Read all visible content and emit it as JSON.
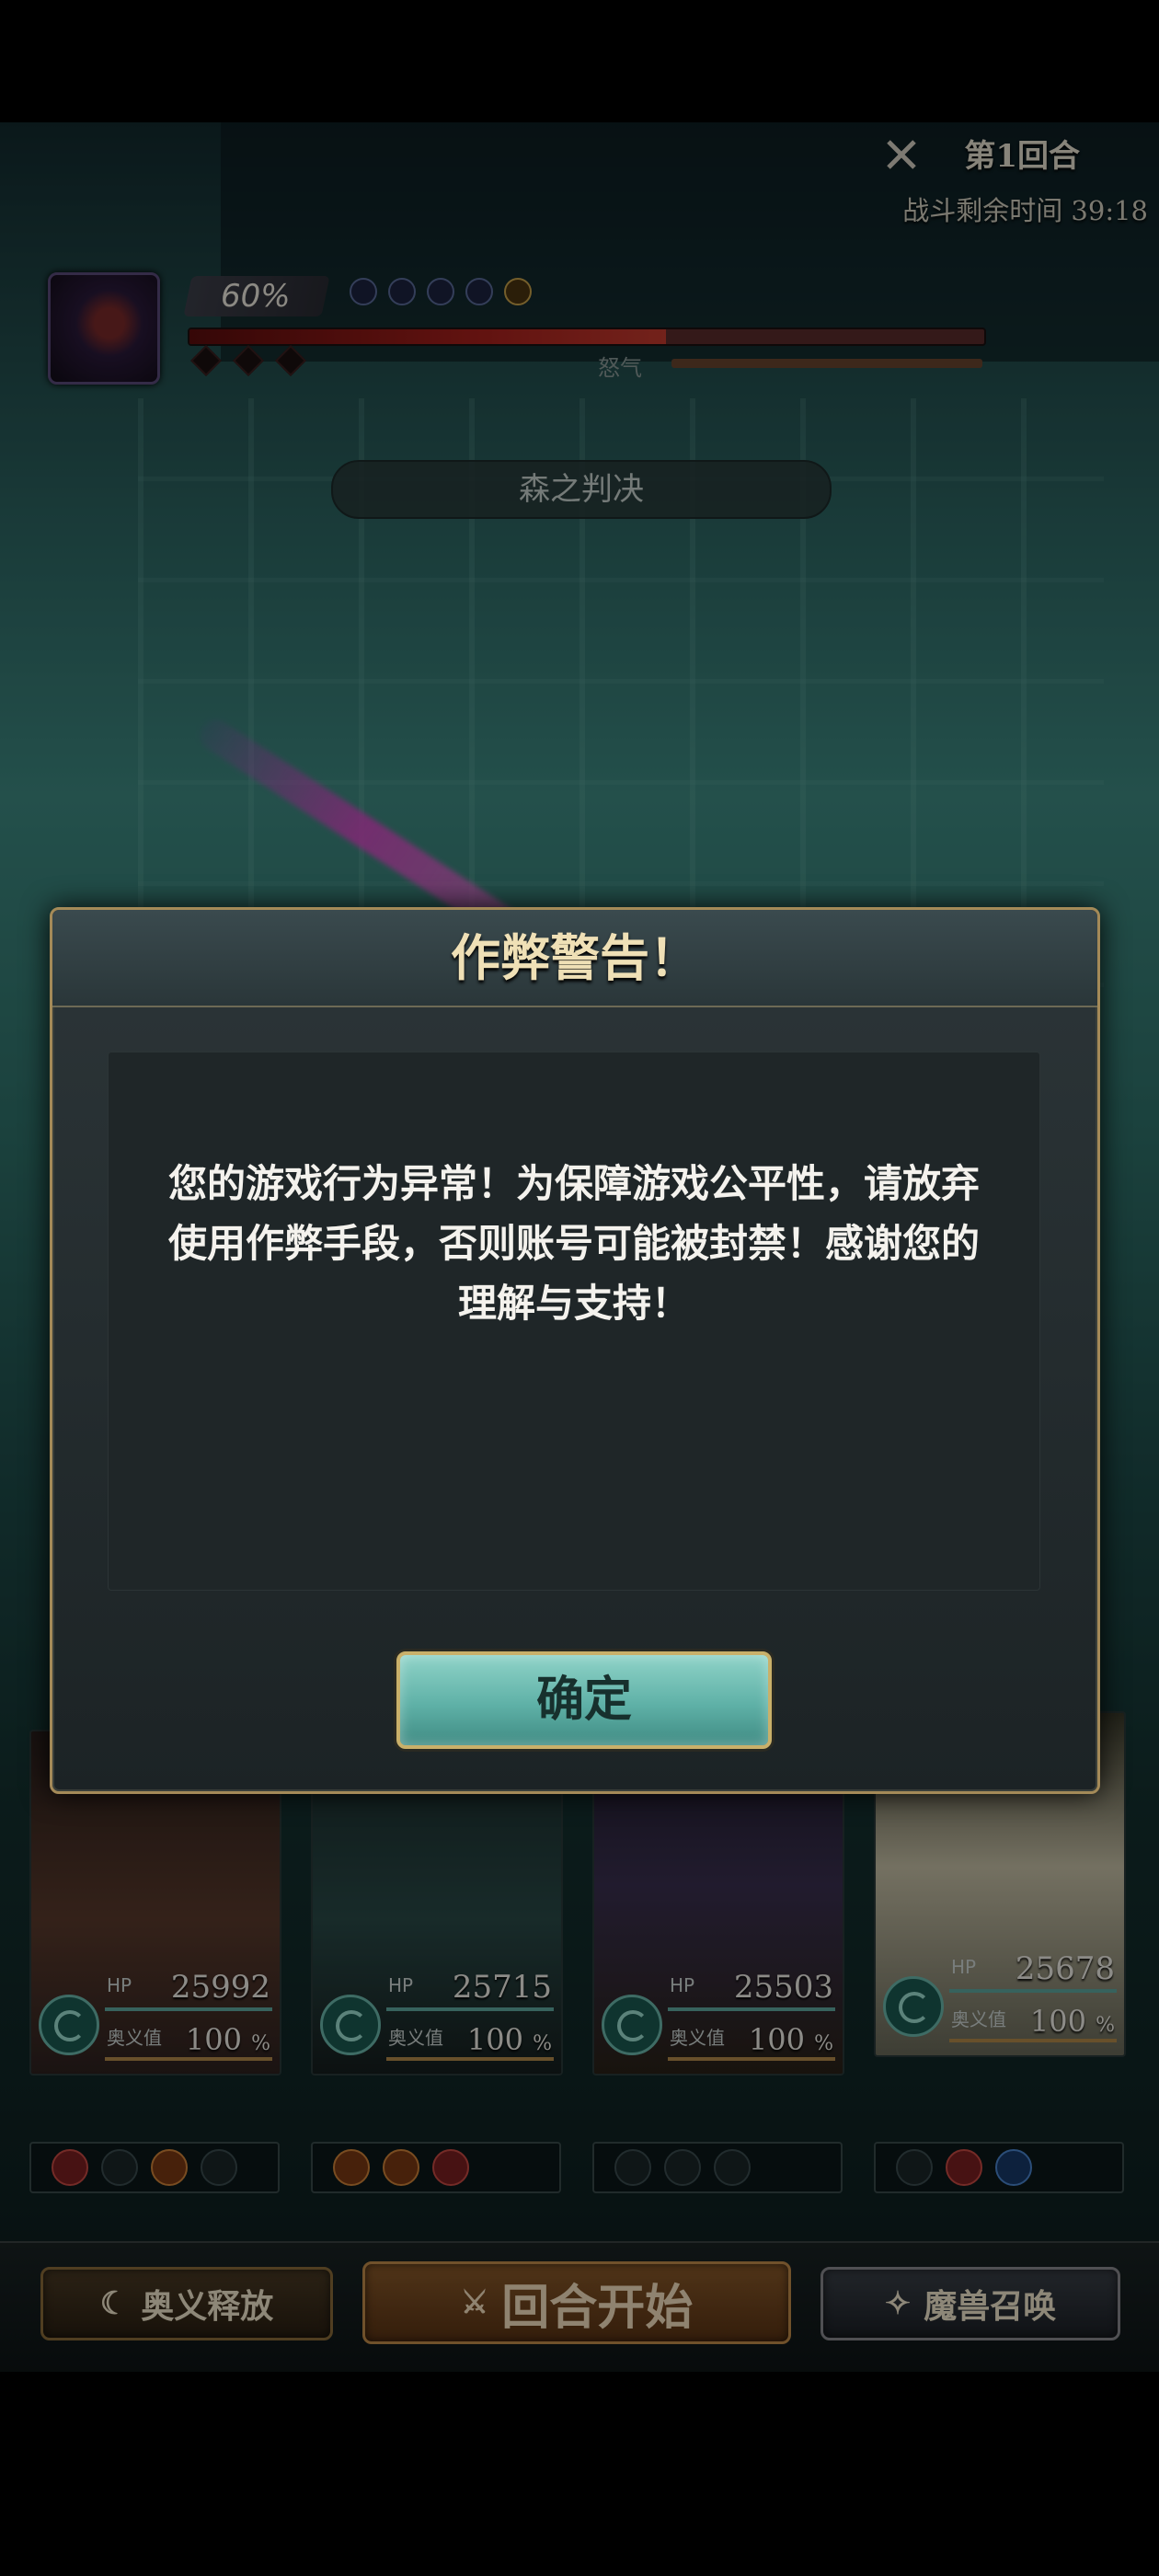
{
  "hud": {
    "turn_label": "第1回合",
    "time_label": "战斗剩余时间 39:18",
    "boss_hp_percent": "60%",
    "boss_hp_fraction": 0.6,
    "rage_label": "怒气",
    "skill_name": "森之判决"
  },
  "party": [
    {
      "hp_label": "HP",
      "hp": "25992",
      "ougi_label": "奥义值",
      "ougi": "100",
      "pct_sign": "%"
    },
    {
      "hp_label": "HP",
      "hp": "25715",
      "ougi_label": "奥义值",
      "ougi": "100",
      "pct_sign": "%"
    },
    {
      "hp_label": "HP",
      "hp": "25503",
      "ougi_label": "奥义值",
      "ougi": "100",
      "pct_sign": "%"
    },
    {
      "hp_label": "HP",
      "hp": "25678",
      "ougi_label": "奥义值",
      "ougi": "100",
      "pct_sign": "%"
    }
  ],
  "bottom": {
    "left_label": "奥义释放",
    "mid_label": "回合开始",
    "right_label": "魔兽召唤"
  },
  "dialog": {
    "title": "作弊警告！",
    "message": "您的游戏行为异常！为保障游戏公平性，请放弃使用作弊手段，否则账号可能被封禁！感谢您的理解与支持！",
    "confirm_label": "确定"
  },
  "colors": {
    "accent_gold": "#c9b06a",
    "confirm_teal": "#5fb1a7",
    "boss_hp_red": "#a8201c"
  }
}
